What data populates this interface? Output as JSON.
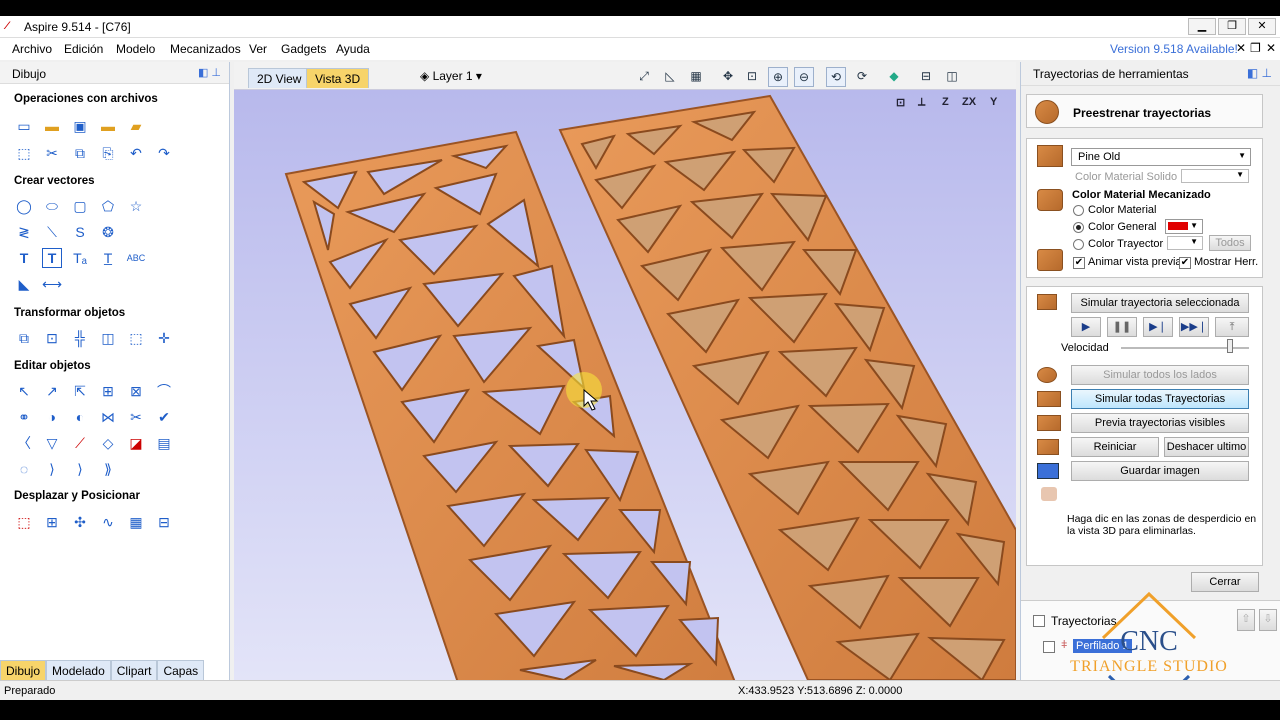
{
  "window": {
    "title": "Aspire 9.514 - [C76]",
    "minimize": "▁",
    "maximize": "❐",
    "close": "✕"
  },
  "menu": [
    "Archivo",
    "Edición",
    "Modelo",
    "Mecanizados",
    "Ver",
    "Gadgets",
    "Ayuda"
  ],
  "version_notice": "Version 9.518 Available!",
  "left_panel": {
    "title": "Dibujo",
    "sections": [
      "Operaciones con archivos",
      "Crear vectores",
      "Transformar objetos",
      "Editar objetos",
      "Desplazar y Posicionar"
    ],
    "tabs": [
      "Dibujo",
      "Modelado",
      "Clipart",
      "Capas"
    ]
  },
  "view": {
    "tabs": [
      "2D View",
      "Vista 3D"
    ],
    "layer": "Layer 1",
    "axis_buttons": [
      "⊡",
      "⟂",
      "Z",
      "ZX",
      "Y"
    ]
  },
  "right_panel": {
    "title": "Trayectorias de herramientas",
    "preview_title": "Preestrenar trayectorias",
    "material": "Pine Old",
    "color_material_solido": "Color Material Solido",
    "color_material_mecanizado": "Color Material Mecanizado",
    "radio_options": [
      "Color Material",
      "Color General",
      "Color Trayectoria"
    ],
    "selected_radio": "Color General",
    "todos": "Todos",
    "animar": "Animar vista previa",
    "mostrar": "Mostrar Herr.",
    "simular_sel": "Simular trayectoria seleccionada",
    "velocidad": "Velocidad",
    "velocidad_level": 0.85,
    "simular_lados": "Simular todos los lados",
    "simular_todas": "Simular todas Trayectorias",
    "previa": "Previa trayectorias visibles",
    "reiniciar": "Reiniciar",
    "deshacer": "Deshacer ultimo",
    "guardar": "Guardar imagen",
    "hint": "Haga dic en las zonas de desperdicio en la vista 3D para eliminarlas.",
    "cerrar": "Cerrar",
    "toolpaths_label": "Trayectorias",
    "toolpath_item": "Perfilado 1"
  },
  "watermark": {
    "line1": "CNC",
    "line2": "TRIANGLE STUDIO"
  },
  "status": {
    "left": "Preparado",
    "coords": "X:433.9523 Y:513.6896 Z:  0.0000"
  },
  "colors": {
    "wood": "#d9874a",
    "wood_dark": "#9b5424",
    "accent": "#3a6fd8",
    "general_color": "#e00000"
  }
}
